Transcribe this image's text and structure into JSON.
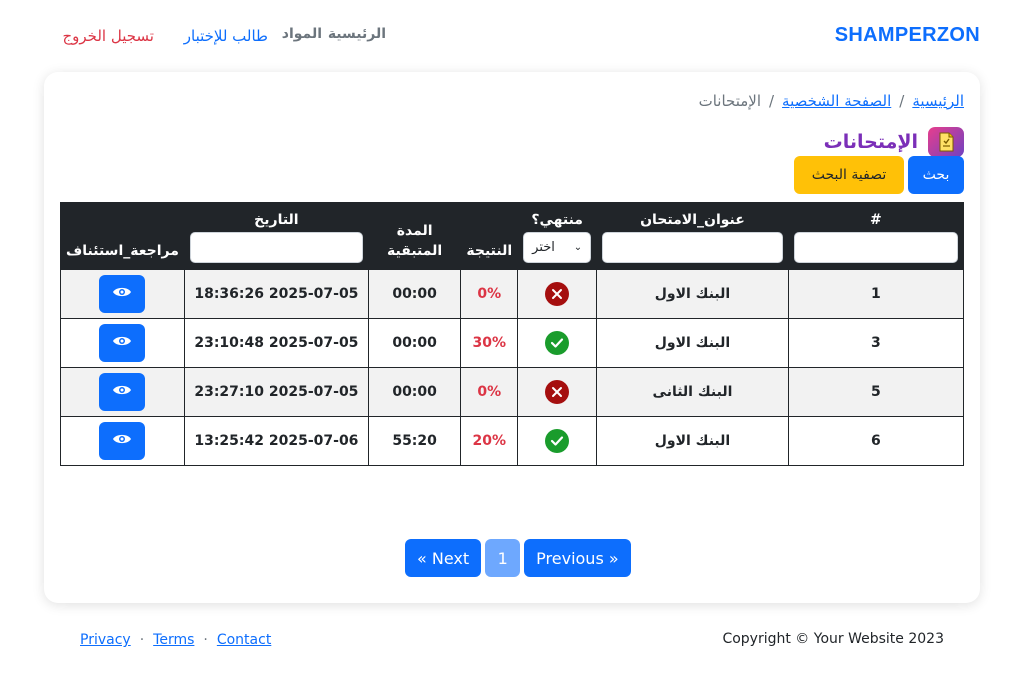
{
  "nav": {
    "brand": "SHAMPERZON",
    "home": "الرئيسية",
    "subjects": "المواد",
    "student_exam": "طالب للإختبار",
    "logout": "تسجيل الخروج"
  },
  "breadcrumb": {
    "home": "الرئيسية",
    "profile": "الصفحة الشخصية",
    "current": "الإمتحانات",
    "separator": "/"
  },
  "section": {
    "title": "الإمتحانات",
    "icon": "exam-document-icon"
  },
  "buttons": {
    "search": "بحث",
    "filter": "تصفية البحث"
  },
  "table": {
    "headers": {
      "id": "#",
      "title": "عنوان_الامتحان",
      "ended": "منتهي؟",
      "score": "النتيجة",
      "duration_line1": "المدة",
      "duration_line2": "المتبقية",
      "date": "التاريخ",
      "review": "مراجعة_استئناف"
    },
    "ended_select": "اختر",
    "rows": [
      {
        "id": "1",
        "title": "البنك الاول",
        "ended": "fail",
        "score": "0%",
        "duration": "00:00",
        "date": "2025-07-05 18:36:26"
      },
      {
        "id": "3",
        "title": "البنك الاول",
        "ended": "pass",
        "score": "30%",
        "duration": "00:00",
        "date": "2025-07-05 23:10:48"
      },
      {
        "id": "5",
        "title": "البنك الثانى",
        "ended": "fail",
        "score": "0%",
        "duration": "00:00",
        "date": "2025-07-05 23:27:10"
      },
      {
        "id": "6",
        "title": "البنك الاول",
        "ended": "pass",
        "score": "20%",
        "duration": "55:20",
        "date": "2025-07-06 13:25:42"
      }
    ]
  },
  "pagination": {
    "previous": "Previous »",
    "current": "1",
    "next": "« Next"
  },
  "footer": {
    "copyright": "Copyright © Your Website 2023",
    "privacy": "Privacy",
    "terms": "Terms",
    "contact": "Contact",
    "separator": "·"
  },
  "colors": {
    "primary": "#0d6efd",
    "warning": "#ffc107",
    "danger": "#dc3545",
    "header_dark": "#212529",
    "title_purple": "#7b2fb8"
  }
}
